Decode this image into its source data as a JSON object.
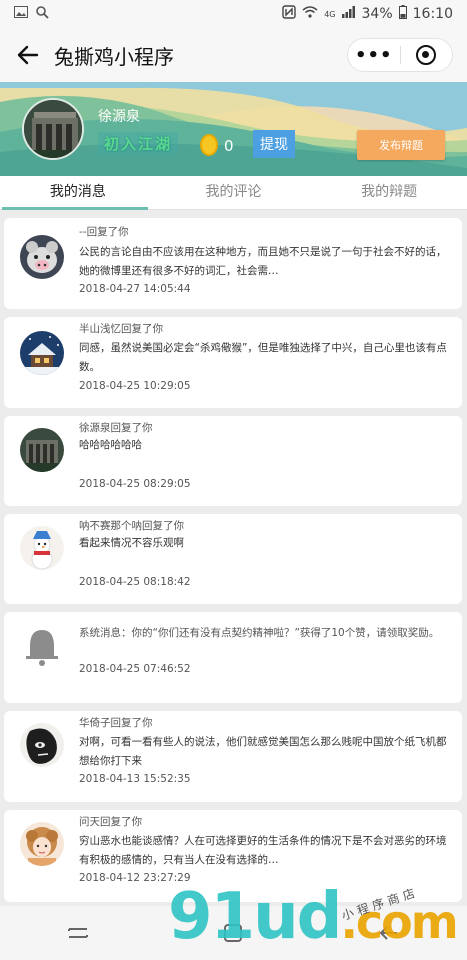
{
  "status_bar": {
    "time": "16:10",
    "battery": "34%",
    "network": "4G"
  },
  "titlebar": {
    "title": "兔撕鸡小程序",
    "more_label": "•••"
  },
  "profile": {
    "name": "徐源泉",
    "rank": "初入江湖",
    "coins": "0",
    "withdraw_label": "提现",
    "publish_label": "发布辩题"
  },
  "tabs": [
    {
      "label": "我的消息",
      "active": true
    },
    {
      "label": "我的评论",
      "active": false
    },
    {
      "label": "我的辩题",
      "active": false
    }
  ],
  "messages": [
    {
      "from": "--回复了你",
      "content": "公民的言论自由不应该用在这种地方，而且她不只是说了一句于社会不好的话，她的微博里还有很多不好的词汇，社会需…",
      "time": "2018-04-27 14:05:44",
      "avatar": "pig-avatar"
    },
    {
      "from": "半山浅忆回复了你",
      "content": "同感，虽然说美国必定会“杀鸡儆猴”，但是唯独选择了中兴，自己心里也该有点数。",
      "time": "2018-04-25 10:29:05",
      "avatar": "snow-house-avatar"
    },
    {
      "from": "徐源泉回复了你",
      "content": "哈哈哈哈哈哈",
      "time": "2018-04-25 08:29:05",
      "avatar": "building-avatar"
    },
    {
      "from": "呐不赛那个呐回复了你",
      "content": "看起来情况不容乐观啊",
      "time": "2018-04-25 08:18:42",
      "avatar": "snowman-avatar"
    },
    {
      "from": "系统消息：你的“你们还有没有点契约精神啦？”获得了10个赞，请领取奖励。",
      "content": "",
      "time": "2018-04-25 07:46:52",
      "avatar": "bell-avatar"
    },
    {
      "from": "华倚子回复了你",
      "content": "对啊，可看一看有些人的说法，他们就感觉美国怎么那么贱呢中国放个纸飞机都想给你打下来",
      "time": "2018-04-13 15:52:35",
      "avatar": "ink-face-avatar"
    },
    {
      "from": "问天回复了你",
      "content": "穷山恶水也能谈感情？人在可选择更好的生活条件的情况下是不会对恶劣的环境有积极的感情的，只有当人在没有选择的…",
      "time": "2018-04-12 23:27:29",
      "avatar": "girl-avatar"
    }
  ],
  "watermark": {
    "main": "91ud",
    "tld": ".com",
    "caption": "小程序商店"
  }
}
